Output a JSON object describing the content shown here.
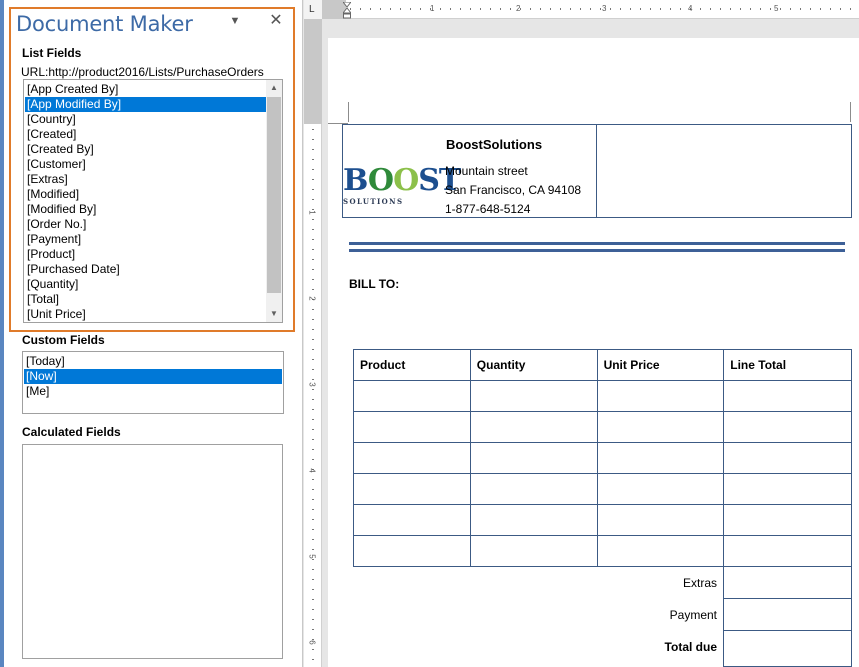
{
  "pane": {
    "title": "Document Maker",
    "menu_glyph": "▼",
    "close_glyph": "✕",
    "list_fields": {
      "label": "List Fields",
      "url": "URL:http://product2016/Lists/PurchaseOrders",
      "items": [
        "[App Created By]",
        "[App Modified By]",
        "[Country]",
        "[Created]",
        "[Created By]",
        "[Customer]",
        "[Extras]",
        "[Modified]",
        "[Modified By]",
        "[Order No.]",
        "[Payment]",
        "[Product]",
        "[Purchased Date]",
        "[Quantity]",
        "[Total]",
        "[Unit Price]"
      ],
      "selected": "[App Modified By]"
    },
    "custom_fields": {
      "label": "Custom Fields",
      "items": [
        "[Today]",
        "[Now]",
        "[Me]"
      ],
      "selected": "[Now]"
    },
    "calculated_fields": {
      "label": "Calculated Fields"
    }
  },
  "ruler": {
    "corner": "L",
    "h_numbers": [
      "1",
      "2",
      "3",
      "4",
      "5"
    ],
    "v_numbers": [
      "1",
      "2",
      "3",
      "4",
      "5",
      "6"
    ]
  },
  "document": {
    "company": {
      "name": "BoostSolutions",
      "street": "Mountain street",
      "city": "San Francisco, CA 94108",
      "phone": "1-877-648-5124"
    },
    "logo": {
      "main_b": "B",
      "main_o1": "O",
      "main_o2": "O",
      "main_st": "ST",
      "sub": "SOLUTIONS"
    },
    "bill_to": "BILL TO:",
    "table": {
      "headers": [
        "Product",
        "Quantity",
        "Unit Price",
        "Line Total"
      ],
      "empty_rows": 6
    },
    "totals": [
      {
        "label": "Extras",
        "bold": false
      },
      {
        "label": "Payment",
        "bold": false
      },
      {
        "label": "Total due",
        "bold": true
      }
    ]
  },
  "colors": {
    "accent_blue": "#3d6aa6",
    "selection": "#0078d7",
    "highlight_frame": "#e07b2a",
    "table_border": "#3c5a84"
  }
}
